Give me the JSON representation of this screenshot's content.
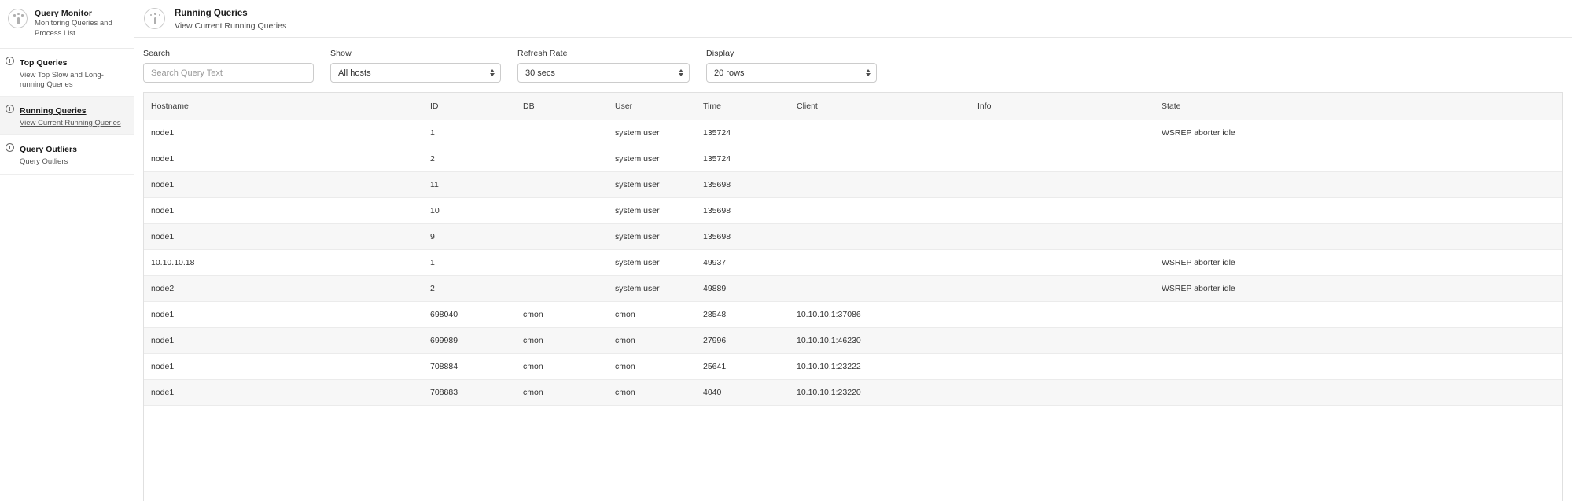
{
  "sidebar": {
    "brand": {
      "icon": "query-monitor-icon",
      "title": "Query Monitor",
      "subtitle": "Monitoring Queries and Process List"
    },
    "items": [
      {
        "icon": "clock-icon",
        "label": "Top Queries",
        "desc": "View Top Slow and Long-running Queries",
        "active": false
      },
      {
        "icon": "clock-icon",
        "label": "Running Queries",
        "desc": "View Current Running Queries",
        "active": true
      },
      {
        "icon": "clock-icon",
        "label": "Query Outliers",
        "desc": "Query Outliers",
        "active": false
      }
    ]
  },
  "header": {
    "icon": "query-monitor-icon",
    "title": "Running Queries",
    "subtitle": "View Current Running Queries"
  },
  "filters": {
    "search": {
      "label": "Search",
      "value": "",
      "placeholder": "Search Query Text"
    },
    "show": {
      "label": "Show",
      "value": "All hosts"
    },
    "refresh_rate": {
      "label": "Refresh Rate",
      "value": "30 secs"
    },
    "display": {
      "label": "Display",
      "value": "20 rows"
    }
  },
  "table": {
    "columns": [
      "Hostname",
      "ID",
      "DB",
      "User",
      "Time",
      "Client",
      "Info",
      "State"
    ],
    "rows": [
      {
        "hostname": "node1",
        "id": "1",
        "db": "",
        "user": "system user",
        "time": "135724",
        "client": "",
        "info": "",
        "state": "WSREP aborter idle"
      },
      {
        "hostname": "node1",
        "id": "2",
        "db": "",
        "user": "system user",
        "time": "135724",
        "client": "",
        "info": "",
        "state": ""
      },
      {
        "hostname": "node1",
        "id": "11",
        "db": "",
        "user": "system user",
        "time": "135698",
        "client": "",
        "info": "",
        "state": ""
      },
      {
        "hostname": "node1",
        "id": "10",
        "db": "",
        "user": "system user",
        "time": "135698",
        "client": "",
        "info": "",
        "state": ""
      },
      {
        "hostname": "node1",
        "id": "9",
        "db": "",
        "user": "system user",
        "time": "135698",
        "client": "",
        "info": "",
        "state": ""
      },
      {
        "hostname": "10.10.10.18",
        "id": "1",
        "db": "",
        "user": "system user",
        "time": "49937",
        "client": "",
        "info": "",
        "state": "WSREP aborter idle"
      },
      {
        "hostname": "node2",
        "id": "2",
        "db": "",
        "user": "system user",
        "time": "49889",
        "client": "",
        "info": "",
        "state": "WSREP aborter idle"
      },
      {
        "hostname": "node1",
        "id": "698040",
        "db": "cmon",
        "user": "cmon",
        "time": "28548",
        "client": "10.10.10.1:37086",
        "info": "",
        "state": ""
      },
      {
        "hostname": "node1",
        "id": "699989",
        "db": "cmon",
        "user": "cmon",
        "time": "27996",
        "client": "10.10.10.1:46230",
        "info": "",
        "state": ""
      },
      {
        "hostname": "node1",
        "id": "708884",
        "db": "cmon",
        "user": "cmon",
        "time": "25641",
        "client": "10.10.10.1:23222",
        "info": "",
        "state": ""
      },
      {
        "hostname": "node1",
        "id": "708883",
        "db": "cmon",
        "user": "cmon",
        "time": "4040",
        "client": "10.10.10.1:23220",
        "info": "",
        "state": ""
      }
    ]
  }
}
